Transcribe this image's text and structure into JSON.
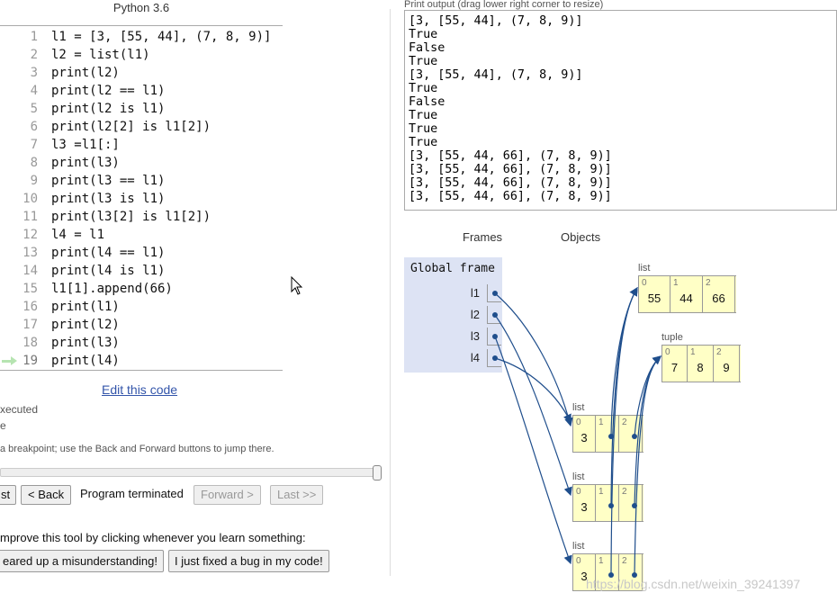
{
  "code_pane": {
    "language": "Python 3.6",
    "current_line": 19,
    "lines": [
      {
        "num": "1",
        "text": "l1 = [3, [55, 44], (7, 8, 9)]"
      },
      {
        "num": "2",
        "text": "l2 = list(l1)"
      },
      {
        "num": "3",
        "text": "print(l2)"
      },
      {
        "num": "4",
        "text": "print(l2 == l1)"
      },
      {
        "num": "5",
        "text": "print(l2 is l1)"
      },
      {
        "num": "6",
        "text": "print(l2[2] is l1[2])"
      },
      {
        "num": "7",
        "text": "l3 =l1[:]"
      },
      {
        "num": "8",
        "text": "print(l3)"
      },
      {
        "num": "9",
        "text": "print(l3 == l1)"
      },
      {
        "num": "10",
        "text": "print(l3 is l1)"
      },
      {
        "num": "11",
        "text": "print(l3[2] is l1[2])"
      },
      {
        "num": "12",
        "text": "l4 = l1"
      },
      {
        "num": "13",
        "text": "print(l4 == l1)"
      },
      {
        "num": "14",
        "text": "print(l4 is l1)"
      },
      {
        "num": "15",
        "text": "l1[1].append(66)"
      },
      {
        "num": "16",
        "text": "print(l1)"
      },
      {
        "num": "17",
        "text": "print(l2)"
      },
      {
        "num": "18",
        "text": "print(l3)"
      },
      {
        "num": "19",
        "text": "print(l4)"
      }
    ],
    "edit_link": "Edit this code",
    "legend_executed": "xecuted",
    "legend_next": "e",
    "hint": "a breakpoint; use the Back and Forward buttons to jump there.",
    "progress": 1.0,
    "buttons": {
      "first": "st",
      "back": "< Back",
      "forward": "Forward >",
      "last": "Last >>"
    },
    "status": "Program terminated",
    "improve_text": "mprove this tool by clicking whenever you learn something:",
    "feedback_buttons": {
      "misunderstanding": "eared up a misunderstanding!",
      "bug": "I just fixed a bug in my code!"
    }
  },
  "output": {
    "label": "Print output (drag lower right corner to resize)",
    "lines": [
      "[3, [55, 44], (7, 8, 9)]",
      "True",
      "False",
      "True",
      "[3, [55, 44], (7, 8, 9)]",
      "True",
      "False",
      "True",
      "True",
      "True",
      "[3, [55, 44, 66], (7, 8, 9)]",
      "[3, [55, 44, 66], (7, 8, 9)]",
      "[3, [55, 44, 66], (7, 8, 9)]",
      "[3, [55, 44, 66], (7, 8, 9)]"
    ]
  },
  "visualization": {
    "frames_heading": "Frames",
    "objects_heading": "Objects",
    "frame_title": "Global frame",
    "variables": [
      "l1",
      "l2",
      "l3",
      "l4"
    ],
    "objects": {
      "inner_list": {
        "type": "list",
        "items": [
          {
            "i": "0",
            "v": "55"
          },
          {
            "i": "1",
            "v": "44"
          },
          {
            "i": "2",
            "v": "66"
          }
        ]
      },
      "tuple": {
        "type": "tuple",
        "items": [
          {
            "i": "0",
            "v": "7"
          },
          {
            "i": "1",
            "v": "8"
          },
          {
            "i": "2",
            "v": "9"
          }
        ]
      },
      "list_a": {
        "type": "list",
        "items": [
          {
            "i": "0",
            "v": "3"
          },
          {
            "i": "1",
            "v": ""
          },
          {
            "i": "2",
            "v": ""
          }
        ]
      },
      "list_b": {
        "type": "list",
        "items": [
          {
            "i": "0",
            "v": "3"
          },
          {
            "i": "1",
            "v": ""
          },
          {
            "i": "2",
            "v": ""
          }
        ]
      },
      "list_c": {
        "type": "list",
        "items": [
          {
            "i": "0",
            "v": "3"
          },
          {
            "i": "1",
            "v": ""
          },
          {
            "i": "2",
            "v": ""
          }
        ]
      }
    },
    "pointer_color": "#1f4e8c"
  },
  "watermark": "https://blog.csdn.net/weixin_39241397"
}
